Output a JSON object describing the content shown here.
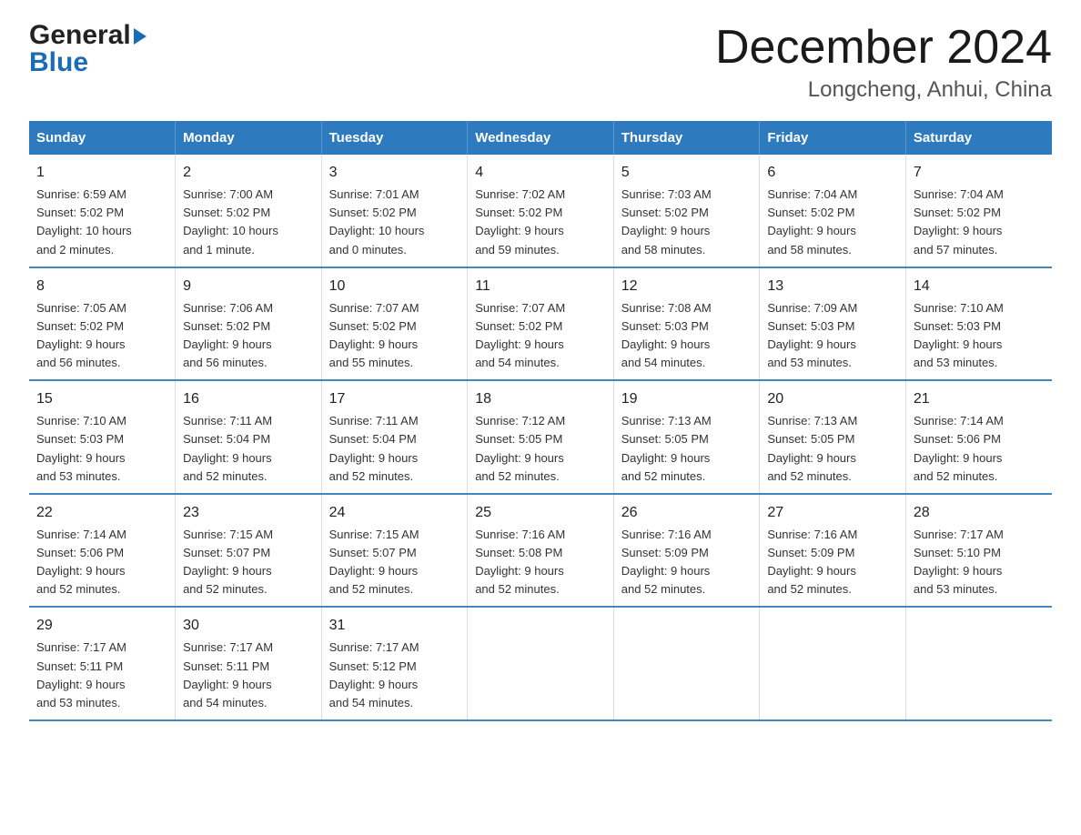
{
  "logo": {
    "general": "General",
    "blue": "Blue"
  },
  "title": "December 2024",
  "subtitle": "Longcheng, Anhui, China",
  "days_of_week": [
    "Sunday",
    "Monday",
    "Tuesday",
    "Wednesday",
    "Thursday",
    "Friday",
    "Saturday"
  ],
  "weeks": [
    [
      {
        "day": "1",
        "sunrise": "6:59 AM",
        "sunset": "5:02 PM",
        "daylight": "10 hours and 2 minutes."
      },
      {
        "day": "2",
        "sunrise": "7:00 AM",
        "sunset": "5:02 PM",
        "daylight": "10 hours and 1 minute."
      },
      {
        "day": "3",
        "sunrise": "7:01 AM",
        "sunset": "5:02 PM",
        "daylight": "10 hours and 0 minutes."
      },
      {
        "day": "4",
        "sunrise": "7:02 AM",
        "sunset": "5:02 PM",
        "daylight": "9 hours and 59 minutes."
      },
      {
        "day": "5",
        "sunrise": "7:03 AM",
        "sunset": "5:02 PM",
        "daylight": "9 hours and 58 minutes."
      },
      {
        "day": "6",
        "sunrise": "7:04 AM",
        "sunset": "5:02 PM",
        "daylight": "9 hours and 58 minutes."
      },
      {
        "day": "7",
        "sunrise": "7:04 AM",
        "sunset": "5:02 PM",
        "daylight": "9 hours and 57 minutes."
      }
    ],
    [
      {
        "day": "8",
        "sunrise": "7:05 AM",
        "sunset": "5:02 PM",
        "daylight": "9 hours and 56 minutes."
      },
      {
        "day": "9",
        "sunrise": "7:06 AM",
        "sunset": "5:02 PM",
        "daylight": "9 hours and 56 minutes."
      },
      {
        "day": "10",
        "sunrise": "7:07 AM",
        "sunset": "5:02 PM",
        "daylight": "9 hours and 55 minutes."
      },
      {
        "day": "11",
        "sunrise": "7:07 AM",
        "sunset": "5:02 PM",
        "daylight": "9 hours and 54 minutes."
      },
      {
        "day": "12",
        "sunrise": "7:08 AM",
        "sunset": "5:03 PM",
        "daylight": "9 hours and 54 minutes."
      },
      {
        "day": "13",
        "sunrise": "7:09 AM",
        "sunset": "5:03 PM",
        "daylight": "9 hours and 53 minutes."
      },
      {
        "day": "14",
        "sunrise": "7:10 AM",
        "sunset": "5:03 PM",
        "daylight": "9 hours and 53 minutes."
      }
    ],
    [
      {
        "day": "15",
        "sunrise": "7:10 AM",
        "sunset": "5:03 PM",
        "daylight": "9 hours and 53 minutes."
      },
      {
        "day": "16",
        "sunrise": "7:11 AM",
        "sunset": "5:04 PM",
        "daylight": "9 hours and 52 minutes."
      },
      {
        "day": "17",
        "sunrise": "7:11 AM",
        "sunset": "5:04 PM",
        "daylight": "9 hours and 52 minutes."
      },
      {
        "day": "18",
        "sunrise": "7:12 AM",
        "sunset": "5:05 PM",
        "daylight": "9 hours and 52 minutes."
      },
      {
        "day": "19",
        "sunrise": "7:13 AM",
        "sunset": "5:05 PM",
        "daylight": "9 hours and 52 minutes."
      },
      {
        "day": "20",
        "sunrise": "7:13 AM",
        "sunset": "5:05 PM",
        "daylight": "9 hours and 52 minutes."
      },
      {
        "day": "21",
        "sunrise": "7:14 AM",
        "sunset": "5:06 PM",
        "daylight": "9 hours and 52 minutes."
      }
    ],
    [
      {
        "day": "22",
        "sunrise": "7:14 AM",
        "sunset": "5:06 PM",
        "daylight": "9 hours and 52 minutes."
      },
      {
        "day": "23",
        "sunrise": "7:15 AM",
        "sunset": "5:07 PM",
        "daylight": "9 hours and 52 minutes."
      },
      {
        "day": "24",
        "sunrise": "7:15 AM",
        "sunset": "5:07 PM",
        "daylight": "9 hours and 52 minutes."
      },
      {
        "day": "25",
        "sunrise": "7:16 AM",
        "sunset": "5:08 PM",
        "daylight": "9 hours and 52 minutes."
      },
      {
        "day": "26",
        "sunrise": "7:16 AM",
        "sunset": "5:09 PM",
        "daylight": "9 hours and 52 minutes."
      },
      {
        "day": "27",
        "sunrise": "7:16 AM",
        "sunset": "5:09 PM",
        "daylight": "9 hours and 52 minutes."
      },
      {
        "day": "28",
        "sunrise": "7:17 AM",
        "sunset": "5:10 PM",
        "daylight": "9 hours and 53 minutes."
      }
    ],
    [
      {
        "day": "29",
        "sunrise": "7:17 AM",
        "sunset": "5:11 PM",
        "daylight": "9 hours and 53 minutes."
      },
      {
        "day": "30",
        "sunrise": "7:17 AM",
        "sunset": "5:11 PM",
        "daylight": "9 hours and 54 minutes."
      },
      {
        "day": "31",
        "sunrise": "7:17 AM",
        "sunset": "5:12 PM",
        "daylight": "9 hours and 54 minutes."
      },
      null,
      null,
      null,
      null
    ]
  ],
  "labels": {
    "sunrise": "Sunrise:",
    "sunset": "Sunset:",
    "daylight": "Daylight:"
  }
}
